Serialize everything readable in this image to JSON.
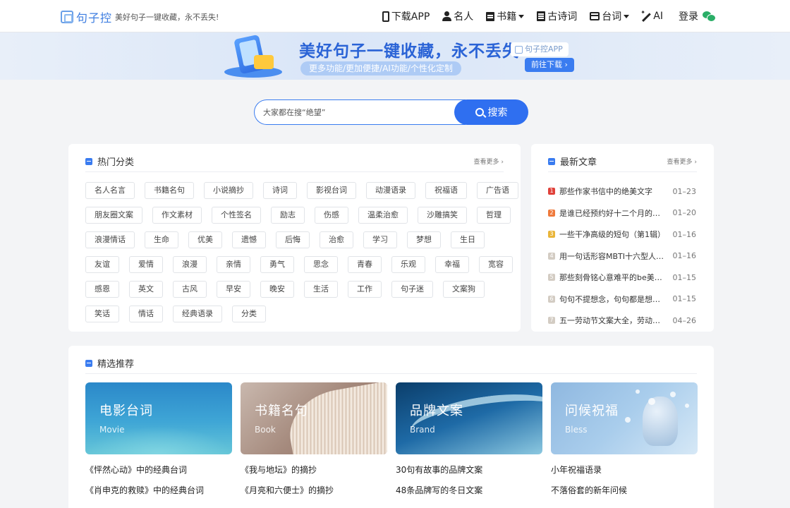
{
  "header": {
    "logo_name": "句子控",
    "slogan": "美好句子一键收藏，永不丢失!",
    "nav": [
      {
        "label": "下载APP",
        "icon": "phone-icon"
      },
      {
        "label": "名人",
        "icon": "user-icon"
      },
      {
        "label": "书籍",
        "icon": "book-icon",
        "dropdown": true
      },
      {
        "label": "古诗词",
        "icon": "document-icon"
      },
      {
        "label": "台词",
        "icon": "film-icon",
        "dropdown": true
      },
      {
        "label": "AI",
        "icon": "magic-wand-icon"
      }
    ],
    "login": "登录"
  },
  "banner": {
    "title": "美好句子一键收藏，永不丢失!",
    "subtitle": "更多功能/更加便捷/AI功能/个性化定制",
    "app_tag": "句子控APP",
    "download": "前往下载 ›"
  },
  "search": {
    "placeholder": "大家都在搜“绝望”",
    "button": "搜索"
  },
  "categories": {
    "title": "热门分类",
    "more": "查看更多 ›",
    "rows": [
      [
        "名人名言",
        "书籍名句",
        "小说摘抄",
        "诗词",
        "影视台词",
        "动漫语录",
        "祝福语",
        "广告语"
      ],
      [
        "朋友圈文案",
        "作文素材",
        "个性签名",
        "励志",
        "伤感",
        "温柔治愈",
        "沙雕搞笑",
        "哲理"
      ],
      [
        "浪漫情话",
        "生命",
        "优美",
        "遗憾",
        "后悔",
        "治愈",
        "学习",
        "梦想",
        "生日"
      ],
      [
        "友谊",
        "爱情",
        "浪漫",
        "亲情",
        "勇气",
        "思念",
        "青春",
        "乐观",
        "幸福",
        "宽容"
      ],
      [
        "感恩",
        "英文",
        "古风",
        "早安",
        "晚安",
        "生活",
        "工作",
        "句子迷",
        "文案狗"
      ],
      [
        "笑话",
        "情话",
        "经典语录",
        "分类"
      ]
    ]
  },
  "articles": {
    "title": "最新文章",
    "more": "查看更多 ›",
    "items": [
      {
        "num": "1",
        "title": "那些作家书信中的绝美文字",
        "date": "01–23",
        "color": "#e0413a"
      },
      {
        "num": "2",
        "title": "是谁已经预约好十二个月的浪漫了",
        "date": "01–20",
        "color": "#ef7a3c"
      },
      {
        "num": "3",
        "title": "一些干净高级的短句（第1辑）",
        "date": "01–16",
        "color": "#e9b53a"
      },
      {
        "num": "4",
        "title": "用一句话形容MBTI十六型人格的特点",
        "date": "01–16",
        "color": "#d3ccc3"
      },
      {
        "num": "5",
        "title": "那些刻骨铭心意难平的be美学句子",
        "date": "01–15",
        "color": "#d3ccc3"
      },
      {
        "num": "6",
        "title": "句句不提想念，句句都是想念的句子",
        "date": "01–15",
        "color": "#d3ccc3"
      },
      {
        "num": "7",
        "title": "五一劳动节文案大全，劳动人民最光荣",
        "date": "04–26",
        "color": "#d3ccc3"
      }
    ]
  },
  "featured": {
    "title": "精选推荐",
    "columns": [
      {
        "title": "电影台词",
        "en": "Movie",
        "links": [
          "《怦然心动》中的经典台词",
          "《肖申克的救赎》中的经典台词"
        ]
      },
      {
        "title": "书籍名句",
        "en": "Book",
        "links": [
          "《我与地坛》的摘抄",
          "《月亮和六便士》的摘抄"
        ]
      },
      {
        "title": "品牌文案",
        "en": "Brand",
        "links": [
          "30句有故事的品牌文案",
          "48条品牌写的冬日文案"
        ]
      },
      {
        "title": "问候祝福",
        "en": "Bless",
        "links": [
          "小年祝福语录",
          "不落俗套的新年问候"
        ]
      }
    ]
  },
  "colors": {
    "accent": "#2f6ff0",
    "brand": "#3d7de0"
  }
}
